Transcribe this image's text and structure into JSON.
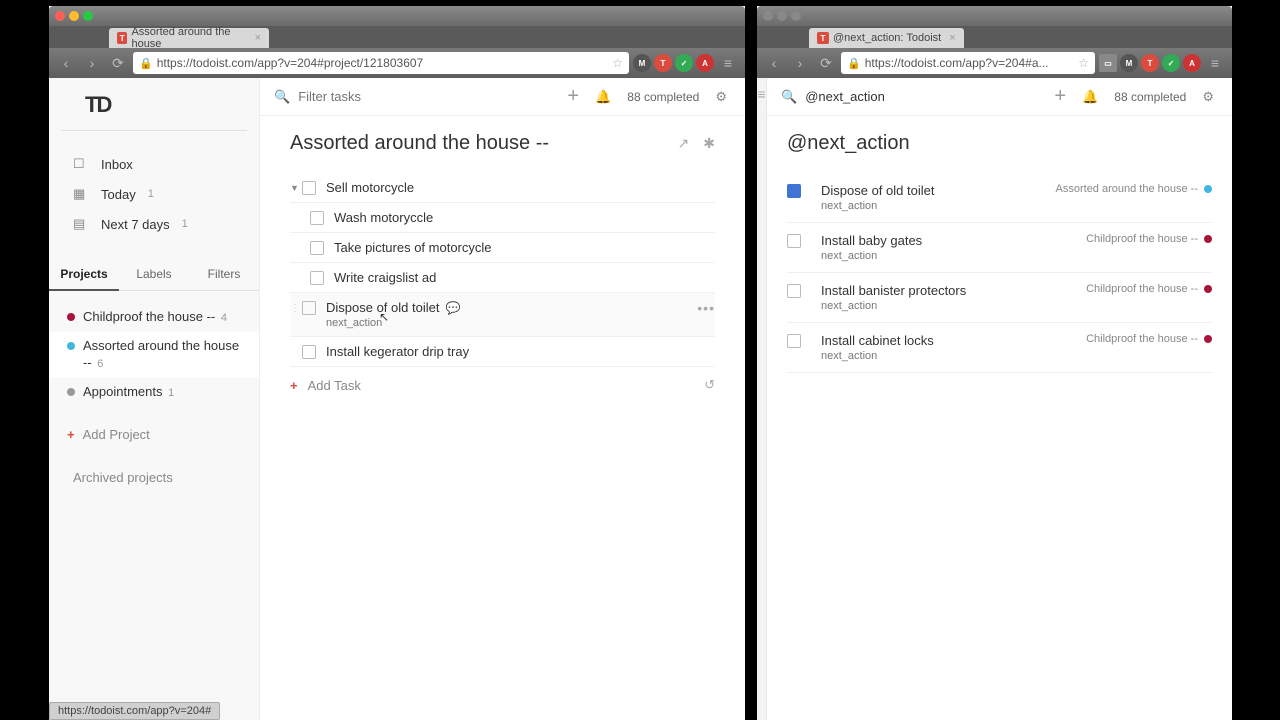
{
  "left": {
    "tab_title": "Assorted around the house",
    "url": "https://todoist.com/app?v=204#project/121803607",
    "logo": "TD",
    "nav": {
      "inbox": "Inbox",
      "today": "Today",
      "today_count": "1",
      "next7": "Next 7 days",
      "next7_count": "1"
    },
    "sidebar_tabs": {
      "projects": "Projects",
      "labels": "Labels",
      "filters": "Filters"
    },
    "projects": [
      {
        "name": "Childproof the house --",
        "count": "4",
        "color": "#a8143a"
      },
      {
        "name": "Assorted around the house --",
        "count": "6",
        "color": "#3fb8e0"
      },
      {
        "name": "Appointments",
        "count": "1",
        "color": "#999"
      }
    ],
    "add_project": "Add Project",
    "archived": "Archived projects",
    "filter_placeholder": "Filter tasks",
    "completed": "88 completed",
    "project_title": "Assorted around the house --",
    "tasks": [
      {
        "text": "Sell motorcycle"
      },
      {
        "text": "Wash motoryccle"
      },
      {
        "text": "Take pictures of motorcycle"
      },
      {
        "text": "Write craigslist ad"
      },
      {
        "text": "Dispose of old toilet",
        "label": "next_action"
      },
      {
        "text": "Install kegerator drip tray"
      }
    ],
    "add_task": "Add Task",
    "status_url": "https://todoist.com/app?v=204#"
  },
  "right": {
    "tab_title": "@next_action: Todoist",
    "url": "https://todoist.com/app?v=204#a...",
    "search_value": "@next_action",
    "completed": "88 completed",
    "title": "@next_action",
    "tasks": [
      {
        "text": "Dispose of old toilet",
        "label": "next_action",
        "project": "Assorted around the house --",
        "color": "#3fb8e0",
        "checked": true
      },
      {
        "text": "Install baby gates",
        "label": "next_action",
        "project": "Childproof the house --",
        "color": "#a8143a"
      },
      {
        "text": "Install banister protectors",
        "label": "next_action",
        "project": "Childproof the house --",
        "color": "#a8143a"
      },
      {
        "text": "Install cabinet locks",
        "label": "next_action",
        "project": "Childproof the house --",
        "color": "#a8143a"
      }
    ]
  }
}
